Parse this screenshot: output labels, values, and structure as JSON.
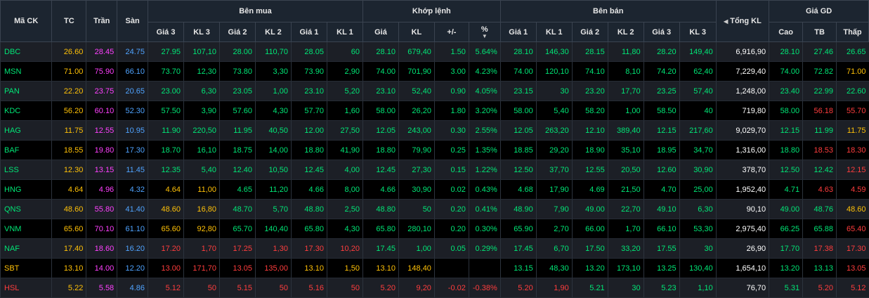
{
  "headers": {
    "symbol": "Mã CK",
    "ref": "TC",
    "ceil": "Trần",
    "floor": "Sàn",
    "bid_group": "Bên mua",
    "match_group": "Khớp lệnh",
    "ask_group": "Bên bán",
    "total_volume": "Tổng KL",
    "price_group": "Giá GD",
    "bid_cols": [
      "Giá 3",
      "KL 3",
      "Giá 2",
      "KL 2",
      "Giá 1",
      "KL 1"
    ],
    "match_cols": [
      "Giá",
      "KL",
      "+/-",
      "%"
    ],
    "ask_cols": [
      "Giá 1",
      "KL 1",
      "Giá 2",
      "KL 2",
      "Giá 3",
      "KL 3"
    ],
    "price_cols": [
      "Cao",
      "TB",
      "Thấp"
    ]
  },
  "icons": {
    "sort_total": "sort-arrows-icon",
    "sort_pct": "sort-desc-icon"
  },
  "colors": {
    "reference": "#ffc107",
    "up": "#00e676",
    "down": "#ff3d3d",
    "ceiling": "#ff40ff",
    "floor": "#4fa3ff"
  },
  "rows": [
    {
      "symbol": "DBC",
      "cells": [
        [
          "26.60",
          "ce"
        ],
        [
          "28.45",
          "ceil"
        ],
        [
          "24.75",
          "floor"
        ],
        [
          "27.95",
          "up"
        ],
        [
          "107,10",
          "up"
        ],
        [
          "28.00",
          "up"
        ],
        [
          "110,70",
          "up"
        ],
        [
          "28.05",
          "up"
        ],
        [
          "60",
          "up"
        ],
        [
          "28.10",
          "up"
        ],
        [
          "679,40",
          "up"
        ],
        [
          "1.50",
          "up"
        ],
        [
          "5.64%",
          "up"
        ],
        [
          "28.10",
          "up"
        ],
        [
          "146,30",
          "up"
        ],
        [
          "28.15",
          "up"
        ],
        [
          "11,80",
          "up"
        ],
        [
          "28.20",
          "up"
        ],
        [
          "149,40",
          "up"
        ],
        [
          "6,916,90",
          "tot"
        ],
        [
          "28.10",
          "up"
        ],
        [
          "27.46",
          "up"
        ],
        [
          "26.65",
          "up"
        ]
      ]
    },
    {
      "symbol": "MSN",
      "cells": [
        [
          "71.00",
          "ce"
        ],
        [
          "75.90",
          "ceil"
        ],
        [
          "66.10",
          "floor"
        ],
        [
          "73.70",
          "up"
        ],
        [
          "12,30",
          "up"
        ],
        [
          "73.80",
          "up"
        ],
        [
          "3,30",
          "up"
        ],
        [
          "73.90",
          "up"
        ],
        [
          "2,90",
          "up"
        ],
        [
          "74.00",
          "up"
        ],
        [
          "701,90",
          "up"
        ],
        [
          "3.00",
          "up"
        ],
        [
          "4.23%",
          "up"
        ],
        [
          "74.00",
          "up"
        ],
        [
          "120,10",
          "up"
        ],
        [
          "74.10",
          "up"
        ],
        [
          "8,10",
          "up"
        ],
        [
          "74.20",
          "up"
        ],
        [
          "62,40",
          "up"
        ],
        [
          "7,229,40",
          "tot"
        ],
        [
          "74.00",
          "up"
        ],
        [
          "72.82",
          "up"
        ],
        [
          "71.00",
          "ce"
        ]
      ]
    },
    {
      "symbol": "PAN",
      "cells": [
        [
          "22.20",
          "ce"
        ],
        [
          "23.75",
          "ceil"
        ],
        [
          "20.65",
          "floor"
        ],
        [
          "23.00",
          "up"
        ],
        [
          "6,30",
          "up"
        ],
        [
          "23.05",
          "up"
        ],
        [
          "1,00",
          "up"
        ],
        [
          "23.10",
          "up"
        ],
        [
          "5,20",
          "up"
        ],
        [
          "23.10",
          "up"
        ],
        [
          "52,40",
          "up"
        ],
        [
          "0.90",
          "up"
        ],
        [
          "4.05%",
          "up"
        ],
        [
          "23.15",
          "up"
        ],
        [
          "30",
          "up"
        ],
        [
          "23.20",
          "up"
        ],
        [
          "17,70",
          "up"
        ],
        [
          "23.25",
          "up"
        ],
        [
          "57,40",
          "up"
        ],
        [
          "1,248,00",
          "tot"
        ],
        [
          "23.40",
          "up"
        ],
        [
          "22.99",
          "up"
        ],
        [
          "22.60",
          "up"
        ]
      ]
    },
    {
      "symbol": "KDC",
      "cells": [
        [
          "56.20",
          "ce"
        ],
        [
          "60.10",
          "ceil"
        ],
        [
          "52.30",
          "floor"
        ],
        [
          "57.50",
          "up"
        ],
        [
          "3,90",
          "up"
        ],
        [
          "57.60",
          "up"
        ],
        [
          "4,30",
          "up"
        ],
        [
          "57.70",
          "up"
        ],
        [
          "1,60",
          "up"
        ],
        [
          "58.00",
          "up"
        ],
        [
          "26,20",
          "up"
        ],
        [
          "1.80",
          "up"
        ],
        [
          "3.20%",
          "up"
        ],
        [
          "58.00",
          "up"
        ],
        [
          "5,40",
          "up"
        ],
        [
          "58.20",
          "up"
        ],
        [
          "1,00",
          "up"
        ],
        [
          "58.50",
          "up"
        ],
        [
          "40",
          "up"
        ],
        [
          "719,80",
          "tot"
        ],
        [
          "58.00",
          "up"
        ],
        [
          "56.18",
          "dn"
        ],
        [
          "55.70",
          "dn"
        ]
      ]
    },
    {
      "symbol": "HAG",
      "cells": [
        [
          "11.75",
          "ce"
        ],
        [
          "12.55",
          "ceil"
        ],
        [
          "10.95",
          "floor"
        ],
        [
          "11.90",
          "up"
        ],
        [
          "220,50",
          "up"
        ],
        [
          "11.95",
          "up"
        ],
        [
          "40,50",
          "up"
        ],
        [
          "12.00",
          "up"
        ],
        [
          "27,50",
          "up"
        ],
        [
          "12.05",
          "up"
        ],
        [
          "243,00",
          "up"
        ],
        [
          "0.30",
          "up"
        ],
        [
          "2.55%",
          "up"
        ],
        [
          "12.05",
          "up"
        ],
        [
          "263,20",
          "up"
        ],
        [
          "12.10",
          "up"
        ],
        [
          "389,40",
          "up"
        ],
        [
          "12.15",
          "up"
        ],
        [
          "217,60",
          "up"
        ],
        [
          "9,029,70",
          "tot"
        ],
        [
          "12.15",
          "up"
        ],
        [
          "11.99",
          "up"
        ],
        [
          "11.75",
          "ce"
        ]
      ]
    },
    {
      "symbol": "BAF",
      "cells": [
        [
          "18.55",
          "ce"
        ],
        [
          "19.80",
          "ceil"
        ],
        [
          "17.30",
          "floor"
        ],
        [
          "18.70",
          "up"
        ],
        [
          "16,10",
          "up"
        ],
        [
          "18.75",
          "up"
        ],
        [
          "14,00",
          "up"
        ],
        [
          "18.80",
          "up"
        ],
        [
          "41,90",
          "up"
        ],
        [
          "18.80",
          "up"
        ],
        [
          "79,90",
          "up"
        ],
        [
          "0.25",
          "up"
        ],
        [
          "1.35%",
          "up"
        ],
        [
          "18.85",
          "up"
        ],
        [
          "29,20",
          "up"
        ],
        [
          "18.90",
          "up"
        ],
        [
          "35,10",
          "up"
        ],
        [
          "18.95",
          "up"
        ],
        [
          "34,70",
          "up"
        ],
        [
          "1,316,00",
          "tot"
        ],
        [
          "18.80",
          "up"
        ],
        [
          "18.53",
          "dn"
        ],
        [
          "18.30",
          "dn"
        ]
      ]
    },
    {
      "symbol": "LSS",
      "cells": [
        [
          "12.30",
          "ce"
        ],
        [
          "13.15",
          "ceil"
        ],
        [
          "11.45",
          "floor"
        ],
        [
          "12.35",
          "up"
        ],
        [
          "5,40",
          "up"
        ],
        [
          "12.40",
          "up"
        ],
        [
          "10,50",
          "up"
        ],
        [
          "12.45",
          "up"
        ],
        [
          "4,00",
          "up"
        ],
        [
          "12.45",
          "up"
        ],
        [
          "27,30",
          "up"
        ],
        [
          "0.15",
          "up"
        ],
        [
          "1.22%",
          "up"
        ],
        [
          "12.50",
          "up"
        ],
        [
          "37,70",
          "up"
        ],
        [
          "12.55",
          "up"
        ],
        [
          "20,50",
          "up"
        ],
        [
          "12.60",
          "up"
        ],
        [
          "30,90",
          "up"
        ],
        [
          "378,70",
          "tot"
        ],
        [
          "12.50",
          "up"
        ],
        [
          "12.42",
          "up"
        ],
        [
          "12.15",
          "dn"
        ]
      ]
    },
    {
      "symbol": "HNG",
      "cells": [
        [
          "4.64",
          "ce"
        ],
        [
          "4.96",
          "ceil"
        ],
        [
          "4.32",
          "floor"
        ],
        [
          "4.64",
          "ce"
        ],
        [
          "11,00",
          "ce"
        ],
        [
          "4.65",
          "up"
        ],
        [
          "11,20",
          "up"
        ],
        [
          "4.66",
          "up"
        ],
        [
          "8,00",
          "up"
        ],
        [
          "4.66",
          "up"
        ],
        [
          "30,90",
          "up"
        ],
        [
          "0.02",
          "up"
        ],
        [
          "0.43%",
          "up"
        ],
        [
          "4.68",
          "up"
        ],
        [
          "17,90",
          "up"
        ],
        [
          "4.69",
          "up"
        ],
        [
          "21,50",
          "up"
        ],
        [
          "4.70",
          "up"
        ],
        [
          "25,00",
          "up"
        ],
        [
          "1,952,40",
          "tot"
        ],
        [
          "4.71",
          "up"
        ],
        [
          "4.63",
          "dn"
        ],
        [
          "4.59",
          "dn"
        ]
      ]
    },
    {
      "symbol": "QNS",
      "cells": [
        [
          "48.60",
          "ce"
        ],
        [
          "55.80",
          "ceil"
        ],
        [
          "41.40",
          "floor"
        ],
        [
          "48.60",
          "ce"
        ],
        [
          "16,80",
          "ce"
        ],
        [
          "48.70",
          "up"
        ],
        [
          "5,70",
          "up"
        ],
        [
          "48.80",
          "up"
        ],
        [
          "2,50",
          "up"
        ],
        [
          "48.80",
          "up"
        ],
        [
          "50",
          "up"
        ],
        [
          "0.20",
          "up"
        ],
        [
          "0.41%",
          "up"
        ],
        [
          "48.90",
          "up"
        ],
        [
          "7,90",
          "up"
        ],
        [
          "49.00",
          "up"
        ],
        [
          "22,70",
          "up"
        ],
        [
          "49.10",
          "up"
        ],
        [
          "6,30",
          "up"
        ],
        [
          "90,10",
          "tot"
        ],
        [
          "49.00",
          "up"
        ],
        [
          "48.76",
          "up"
        ],
        [
          "48.60",
          "ce"
        ]
      ]
    },
    {
      "symbol": "VNM",
      "cells": [
        [
          "65.60",
          "ce"
        ],
        [
          "70.10",
          "ceil"
        ],
        [
          "61.10",
          "floor"
        ],
        [
          "65.60",
          "ce"
        ],
        [
          "92,80",
          "ce"
        ],
        [
          "65.70",
          "up"
        ],
        [
          "140,40",
          "up"
        ],
        [
          "65.80",
          "up"
        ],
        [
          "4,30",
          "up"
        ],
        [
          "65.80",
          "up"
        ],
        [
          "280,10",
          "up"
        ],
        [
          "0.20",
          "up"
        ],
        [
          "0.30%",
          "up"
        ],
        [
          "65.90",
          "up"
        ],
        [
          "2,70",
          "up"
        ],
        [
          "66.00",
          "up"
        ],
        [
          "1,70",
          "up"
        ],
        [
          "66.10",
          "up"
        ],
        [
          "53,30",
          "up"
        ],
        [
          "2,975,40",
          "tot"
        ],
        [
          "66.25",
          "up"
        ],
        [
          "65.88",
          "up"
        ],
        [
          "65.40",
          "dn"
        ]
      ]
    },
    {
      "symbol": "NAF",
      "cells": [
        [
          "17.40",
          "ce"
        ],
        [
          "18.60",
          "ceil"
        ],
        [
          "16.20",
          "floor"
        ],
        [
          "17.20",
          "dn"
        ],
        [
          "1,70",
          "dn"
        ],
        [
          "17.25",
          "dn"
        ],
        [
          "1,30",
          "dn"
        ],
        [
          "17.30",
          "dn"
        ],
        [
          "10,20",
          "dn"
        ],
        [
          "17.45",
          "up"
        ],
        [
          "1,00",
          "up"
        ],
        [
          "0.05",
          "up"
        ],
        [
          "0.29%",
          "up"
        ],
        [
          "17.45",
          "up"
        ],
        [
          "6,70",
          "up"
        ],
        [
          "17.50",
          "up"
        ],
        [
          "33,20",
          "up"
        ],
        [
          "17.55",
          "up"
        ],
        [
          "30",
          "up"
        ],
        [
          "26,90",
          "tot"
        ],
        [
          "17.70",
          "up"
        ],
        [
          "17.38",
          "dn"
        ],
        [
          "17.30",
          "dn"
        ]
      ]
    },
    {
      "symbol": "SBT",
      "cells": [
        [
          "13.10",
          "ce"
        ],
        [
          "14.00",
          "ceil"
        ],
        [
          "12.20",
          "floor"
        ],
        [
          "13.00",
          "dn"
        ],
        [
          "171,70",
          "dn"
        ],
        [
          "13.05",
          "dn"
        ],
        [
          "135,00",
          "dn"
        ],
        [
          "13.10",
          "ce"
        ],
        [
          "1,50",
          "ce"
        ],
        [
          "13.10",
          "ce"
        ],
        [
          "148,40",
          "ce"
        ],
        [
          "",
          ""
        ],
        [
          "",
          ""
        ],
        [
          "13.15",
          "up"
        ],
        [
          "48,30",
          "up"
        ],
        [
          "13.20",
          "up"
        ],
        [
          "173,10",
          "up"
        ],
        [
          "13.25",
          "up"
        ],
        [
          "130,40",
          "up"
        ],
        [
          "1,654,10",
          "tot"
        ],
        [
          "13.20",
          "up"
        ],
        [
          "13.13",
          "up"
        ],
        [
          "13.05",
          "dn"
        ]
      ]
    },
    {
      "symbol": "HSL",
      "cells": [
        [
          "5.22",
          "ce"
        ],
        [
          "5.58",
          "ceil"
        ],
        [
          "4.86",
          "floor"
        ],
        [
          "5.12",
          "dn"
        ],
        [
          "50",
          "dn"
        ],
        [
          "5.15",
          "dn"
        ],
        [
          "50",
          "dn"
        ],
        [
          "5.16",
          "dn"
        ],
        [
          "50",
          "dn"
        ],
        [
          "5.20",
          "dn"
        ],
        [
          "9,20",
          "dn"
        ],
        [
          "-0.02",
          "dn"
        ],
        [
          "-0.38%",
          "dn"
        ],
        [
          "5.20",
          "dn"
        ],
        [
          "1,90",
          "dn"
        ],
        [
          "5.21",
          "up"
        ],
        [
          "30",
          "up"
        ],
        [
          "5.23",
          "up"
        ],
        [
          "1,10",
          "up"
        ],
        [
          "76,70",
          "tot"
        ],
        [
          "5.31",
          "up"
        ],
        [
          "5.20",
          "dn"
        ],
        [
          "5.12",
          "dn"
        ]
      ]
    }
  ]
}
